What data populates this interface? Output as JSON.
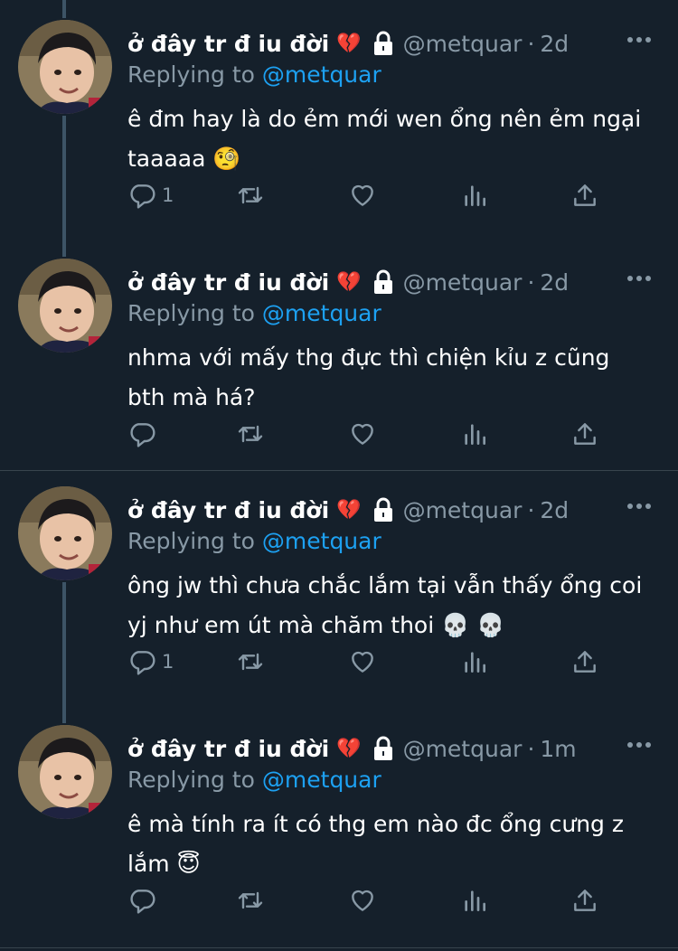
{
  "colors": {
    "background": "#15202b",
    "secondary_text": "#8899a6",
    "link": "#1da1f2",
    "thread_line": "#3d5466"
  },
  "tweets": [
    {
      "name": "ở đây tr đ iu đời",
      "name_emoji": "💔",
      "handle": "@metquar",
      "separator": "·",
      "time": "2d",
      "replying_prefix": "Replying to",
      "replying_to": "@metquar",
      "text": "ê đm hay là do ẻm mới wen ổng nên ẻm ngại taaaaa 🧐",
      "reply_count": "1"
    },
    {
      "name": "ở đây tr đ iu đời",
      "name_emoji": "💔",
      "handle": "@metquar",
      "separator": "·",
      "time": "2d",
      "replying_prefix": "Replying to",
      "replying_to": "@metquar",
      "text": "nhma với mấy thg đực thì chiện kỉu z cũng bth mà há?",
      "reply_count": ""
    },
    {
      "name": "ở đây tr đ iu đời",
      "name_emoji": "💔",
      "handle": "@metquar",
      "separator": "·",
      "time": "2d",
      "replying_prefix": "Replying to",
      "replying_to": "@metquar",
      "text": "ông jw thì chưa chắc lắm tại vẫn thấy ổng coi yj như em út mà chăm thoi 💀 💀",
      "reply_count": "1"
    },
    {
      "name": "ở đây tr đ iu đời",
      "name_emoji": "💔",
      "handle": "@metquar",
      "separator": "·",
      "time": "1m",
      "replying_prefix": "Replying to",
      "replying_to": "@metquar",
      "text": "ê mà tính ra ít có thg em nào đc ổng cưng z lắm 😇",
      "reply_count": ""
    }
  ]
}
